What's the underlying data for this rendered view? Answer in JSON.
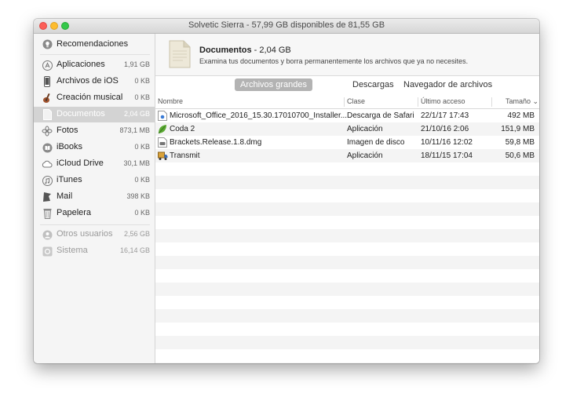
{
  "window": {
    "title": "Solvetic Sierra - 57,99 GB disponibles de 81,55 GB"
  },
  "sidebar": {
    "items": [
      {
        "label": "Recomendaciones",
        "size": "",
        "icon": "lightbulb-icon"
      },
      {
        "label": "Aplicaciones",
        "size": "1,91 GB",
        "icon": "app-store-icon"
      },
      {
        "label": "Archivos de iOS",
        "size": "0 KB",
        "icon": "iphone-icon"
      },
      {
        "label": "Creación musical",
        "size": "0 KB",
        "icon": "guitar-icon"
      },
      {
        "label": "Documentos",
        "size": "2,04 GB",
        "icon": "document-icon"
      },
      {
        "label": "Fotos",
        "size": "873,1 MB",
        "icon": "photos-icon"
      },
      {
        "label": "iBooks",
        "size": "0 KB",
        "icon": "ibooks-icon"
      },
      {
        "label": "iCloud Drive",
        "size": "30,1 MB",
        "icon": "cloud-icon"
      },
      {
        "label": "iTunes",
        "size": "0 KB",
        "icon": "music-note-icon"
      },
      {
        "label": "Mail",
        "size": "398 KB",
        "icon": "mail-icon"
      },
      {
        "label": "Papelera",
        "size": "0 KB",
        "icon": "trash-icon"
      },
      {
        "label": "Otros usuarios",
        "size": "2,56 GB",
        "icon": "users-icon"
      },
      {
        "label": "Sistema",
        "size": "16,14 GB",
        "icon": "system-icon"
      }
    ]
  },
  "header": {
    "title": "Documentos",
    "size": " - 2,04 GB",
    "description": "Examina tus documentos y borra permanentemente los archivos que ya no necesites."
  },
  "tabs": [
    "Archivos grandes",
    "Descargas",
    "Navegador de archivos"
  ],
  "table": {
    "columns": [
      "Nombre",
      "Clase",
      "Último acceso",
      "Tamaño"
    ],
    "rows": [
      {
        "name": "Microsoft_Office_2016_15.30.17010700_Installer....",
        "kind": "Descarga de Safari",
        "accessed": "22/1/17 17:43",
        "size": "492 MB",
        "icon": "installer-package-icon"
      },
      {
        "name": "Coda 2",
        "kind": "Aplicación",
        "accessed": "21/10/16 2:06",
        "size": "151,9 MB",
        "icon": "coda-leaf-icon"
      },
      {
        "name": "Brackets.Release.1.8.dmg",
        "kind": "Imagen de disco",
        "accessed": "10/11/16 12:02",
        "size": "59,8 MB",
        "icon": "disk-image-icon"
      },
      {
        "name": "Transmit",
        "kind": "Aplicación",
        "accessed": "18/11/15 17:04",
        "size": "50,6 MB",
        "icon": "transmit-truck-icon"
      }
    ]
  },
  "colors": {
    "selection": "#d3d3d3",
    "tab_active": "#b3b3b3",
    "close": "#fc5f57",
    "minimize": "#fdbc2e",
    "maximize": "#34c84a"
  }
}
